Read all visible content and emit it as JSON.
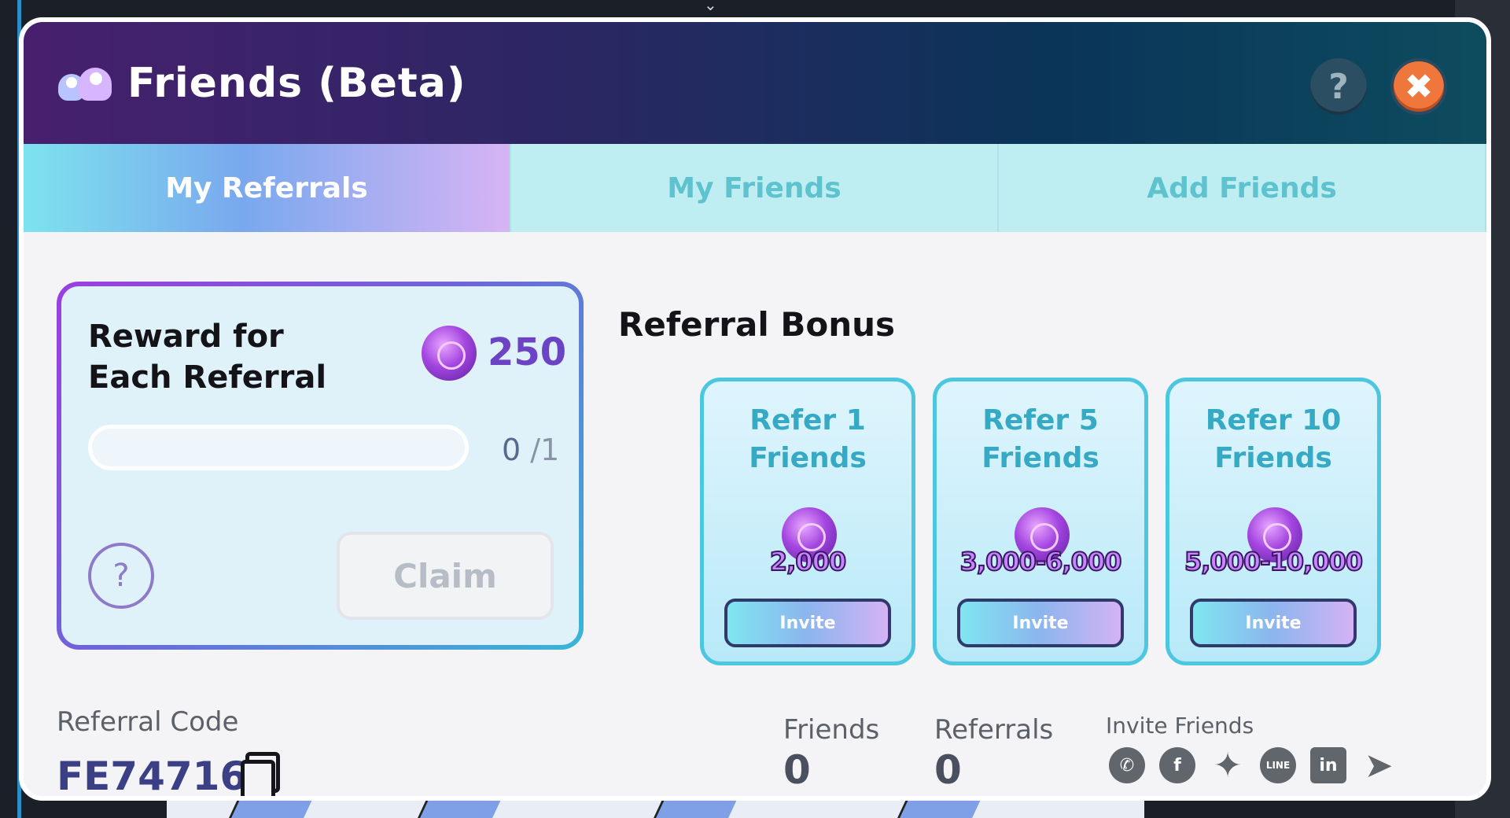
{
  "window": {
    "title": "Friends (Beta)"
  },
  "header": {
    "help_label": "?",
    "close_label": "✖"
  },
  "tabs": [
    {
      "label": "My Referrals",
      "active": true
    },
    {
      "label": "My Friends",
      "active": false
    },
    {
      "label": "Add Friends",
      "active": false
    }
  ],
  "reward": {
    "title": "Reward for Each Referral",
    "amount": "250",
    "progress_current": "0",
    "progress_max": "/1",
    "progress_fraction": 0,
    "help_label": "?",
    "claim_label": "Claim"
  },
  "bonus": {
    "title": "Referral Bonus",
    "cards": [
      {
        "label_line1": "Refer 1",
        "label_line2": "Friends",
        "amount": "2,000",
        "invite_label": "Invite"
      },
      {
        "label_line1": "Refer 5",
        "label_line2": "Friends",
        "amount": "3,000-6,000",
        "invite_label": "Invite"
      },
      {
        "label_line1": "Refer 10",
        "label_line2": "Friends",
        "amount": "5,000-10,000",
        "invite_label": "Invite"
      }
    ]
  },
  "footer": {
    "referral_code_label": "Referral Code",
    "referral_code": "FE747161",
    "friends_label": "Friends",
    "friends_count": "0",
    "referrals_label": "Referrals",
    "referrals_count": "0",
    "invite_label": "Invite Friends",
    "social_icons": [
      "whatsapp-icon",
      "facebook-icon",
      "twitter-icon",
      "line-icon",
      "linkedin-icon",
      "telegram-icon"
    ]
  },
  "colors": {
    "header_start": "#47206e",
    "header_end": "#0d4c5f",
    "tab_bg": "#bfeef2",
    "accent_purple": "#6b43c4",
    "accent_teal": "#4dc6df",
    "close_orange": "#f0773b"
  }
}
